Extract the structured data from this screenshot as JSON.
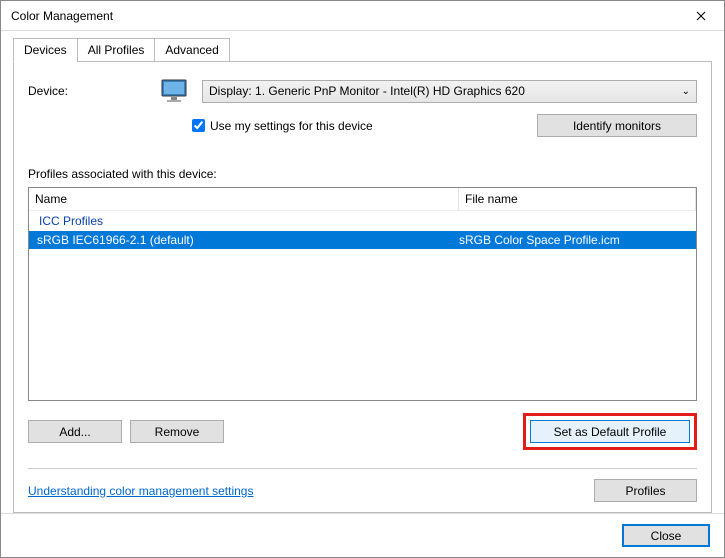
{
  "window": {
    "title": "Color Management"
  },
  "tabs": {
    "devices": "Devices",
    "all_profiles": "All Profiles",
    "advanced": "Advanced"
  },
  "device": {
    "label": "Device:",
    "selected": "Display: 1. Generic PnP Monitor - Intel(R) HD Graphics 620",
    "use_settings_label": "Use my settings for this device",
    "use_settings_checked": true,
    "identify_label": "Identify monitors"
  },
  "profiles_section": {
    "label": "Profiles associated with this device:",
    "columns": {
      "name": "Name",
      "file": "File name"
    },
    "group": "ICC Profiles",
    "rows": [
      {
        "name": "sRGB IEC61966-2.1 (default)",
        "file": "sRGB Color Space Profile.icm",
        "selected": true
      }
    ]
  },
  "actions": {
    "add": "Add...",
    "remove": "Remove",
    "set_default": "Set as Default Profile"
  },
  "link": {
    "label": "Understanding color management settings"
  },
  "profiles_btn": "Profiles",
  "footer": {
    "close": "Close"
  }
}
